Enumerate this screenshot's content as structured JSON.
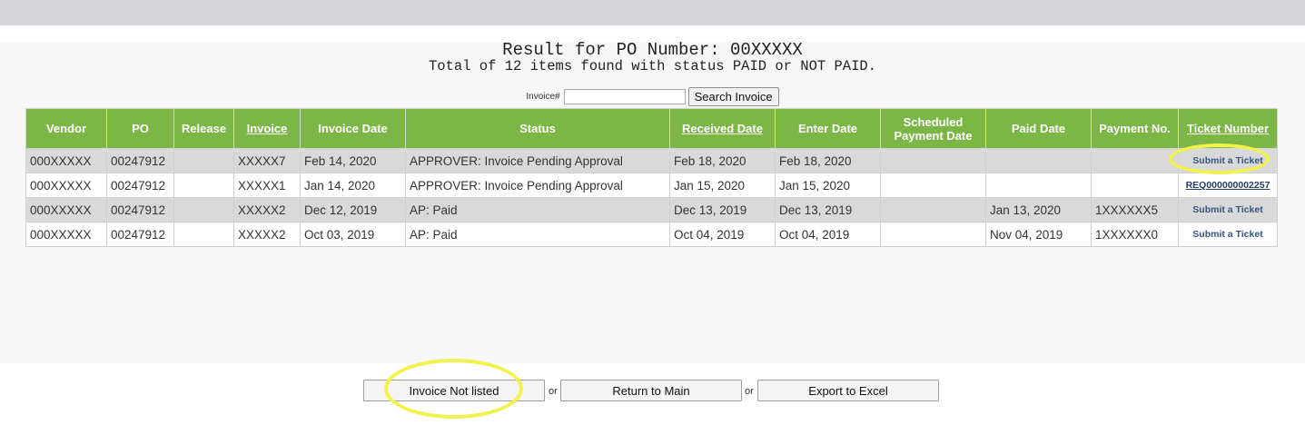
{
  "page": {
    "title": "Result for PO Number: 00XXXXX",
    "subtitle": "Total of 12 items found with status PAID or NOT PAID."
  },
  "search": {
    "label": "Invoice#",
    "value": "",
    "button_label": "Search Invoice"
  },
  "table": {
    "headers": [
      "Vendor",
      "PO",
      "Release",
      "Invoice",
      "Invoice Date",
      "Status",
      "Received Date",
      "Enter Date",
      "Scheduled Payment Date",
      "Paid Date",
      "Payment No.",
      "Ticket Number"
    ],
    "rows": [
      {
        "vendor": "000XXXXX",
        "po": "00247912",
        "release": "",
        "invoice": "XXXXX7",
        "invoice_date": "Feb 14, 2020",
        "status": "APPROVER: Invoice Pending Approval",
        "received_date": "Feb 18, 2020",
        "enter_date": "Feb 18, 2020",
        "scheduled_payment_date": "",
        "paid_date": "",
        "payment_no": "",
        "ticket": "Submit a Ticket"
      },
      {
        "vendor": "000XXXXX",
        "po": "00247912",
        "release": "",
        "invoice": "XXXXX1",
        "invoice_date": "Jan 14, 2020",
        "status": "APPROVER: Invoice Pending Approval",
        "received_date": "Jan 15, 2020",
        "enter_date": "Jan 15, 2020",
        "scheduled_payment_date": "",
        "paid_date": "",
        "payment_no": "",
        "ticket": "REQ000000002257"
      },
      {
        "vendor": "000XXXXX",
        "po": "00247912",
        "release": "",
        "invoice": "XXXXX2",
        "invoice_date": "Dec 12, 2019",
        "status": "AP: Paid",
        "received_date": "Dec 13, 2019",
        "enter_date": "Dec 13, 2019",
        "scheduled_payment_date": "",
        "paid_date": "Jan 13, 2020",
        "payment_no": "1XXXXXX5",
        "ticket": "Submit a Ticket"
      },
      {
        "vendor": "000XXXXX",
        "po": "00247912",
        "release": "",
        "invoice": "XXXXX2",
        "invoice_date": "Oct 03, 2019",
        "status": "AP: Paid",
        "received_date": "Oct 04, 2019",
        "enter_date": "Oct 04, 2019",
        "scheduled_payment_date": "",
        "paid_date": "Nov 04, 2019",
        "payment_no": "1XXXXXX0",
        "ticket": "Submit a Ticket"
      }
    ]
  },
  "footer": {
    "invoice_not_listed_label": "Invoice Not listed",
    "or_1": "or",
    "return_main_label": "Return to Main",
    "or_2": "or",
    "export_excel_label": "Export to Excel"
  },
  "colors": {
    "header_green": "#7bb646",
    "row_gray": "#d9d9d9",
    "highlight_yellow": "#f2f24c"
  }
}
